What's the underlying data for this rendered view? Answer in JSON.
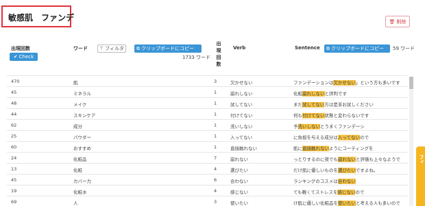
{
  "title": "敏感肌　ファンデ",
  "delete_label": "削除",
  "headers": {
    "count": "出現回数",
    "word": "ワード",
    "occurrences": "出現回数",
    "verb": "Verb",
    "sentence": "Sentence"
  },
  "check_label": "Check",
  "filter_label": "フィルタ",
  "copy_label_word": "クリップボードにコピー",
  "copy_label_sentence": "クリップボードにコピー",
  "word_count": "1733 ワード",
  "sentence_count": "59 ワード",
  "side_tab_label": "フィ",
  "rows": [
    {
      "count": "470",
      "word": "肌",
      "num": "3",
      "verb": "欠かせない",
      "pre": "ファンデーションは",
      "hl": "欠かせない",
      "post": "」という方も多いです"
    },
    {
      "count": "45",
      "word": "ミネラル",
      "num": "1",
      "verb": "崩れしない",
      "pre": "化粧",
      "hl": "崩れしない",
      "post": "と評判です"
    },
    {
      "count": "48",
      "word": "メイク",
      "num": "1",
      "verb": "試してない",
      "pre": "まだ",
      "hl": "試してない",
      "post": "方は是非お試しください"
    },
    {
      "count": "44",
      "word": "スキンケア",
      "num": "1",
      "verb": "付けてない",
      "pre": "何も",
      "hl": "付けてない",
      "post": "状態と変わらないです"
    },
    {
      "count": "62",
      "word": "成分",
      "num": "1",
      "verb": "洗いしない",
      "pre": "予",
      "hl": "洗いしない",
      "post": "とうまくファンデーシ"
    },
    {
      "count": "25",
      "word": "パウダー",
      "num": "1",
      "verb": "入ってない",
      "pre": "に負担を与える成分は",
      "hl": "入ってない",
      "post": "ので"
    },
    {
      "count": "60",
      "word": "おすすめ",
      "num": "1",
      "verb": "直接触れない",
      "pre": "肌に",
      "hl": "直接触れない",
      "post": "ようにコーティングを"
    },
    {
      "count": "24",
      "word": "化粧品",
      "num": "7",
      "verb": "崩れない",
      "pre": "っとりするのに夜でも",
      "hl": "崩れない",
      "post": "と評価も上々なようで"
    },
    {
      "count": "13",
      "word": "化粧",
      "num": "4",
      "verb": "選びたい",
      "pre": "だけ肌に優しいものを",
      "hl": "選びたい",
      "post": "ですよね。"
    },
    {
      "count": "45",
      "word": "カバー力",
      "num": "6",
      "verb": "合わない",
      "pre": "ランキングのコスメは",
      "hl": "合わない",
      "post": ""
    },
    {
      "count": "19",
      "word": "化粧水",
      "num": "4",
      "verb": "感じない",
      "pre": "ても軽くてストレスを",
      "hl": "感じない",
      "post": "ので"
    },
    {
      "count": "69",
      "word": "人",
      "num": "3",
      "verb": "使いたい",
      "pre": "け肌に優しい化粧品を",
      "hl": "使いたい",
      "post": "と考える人も多いので"
    }
  ]
}
